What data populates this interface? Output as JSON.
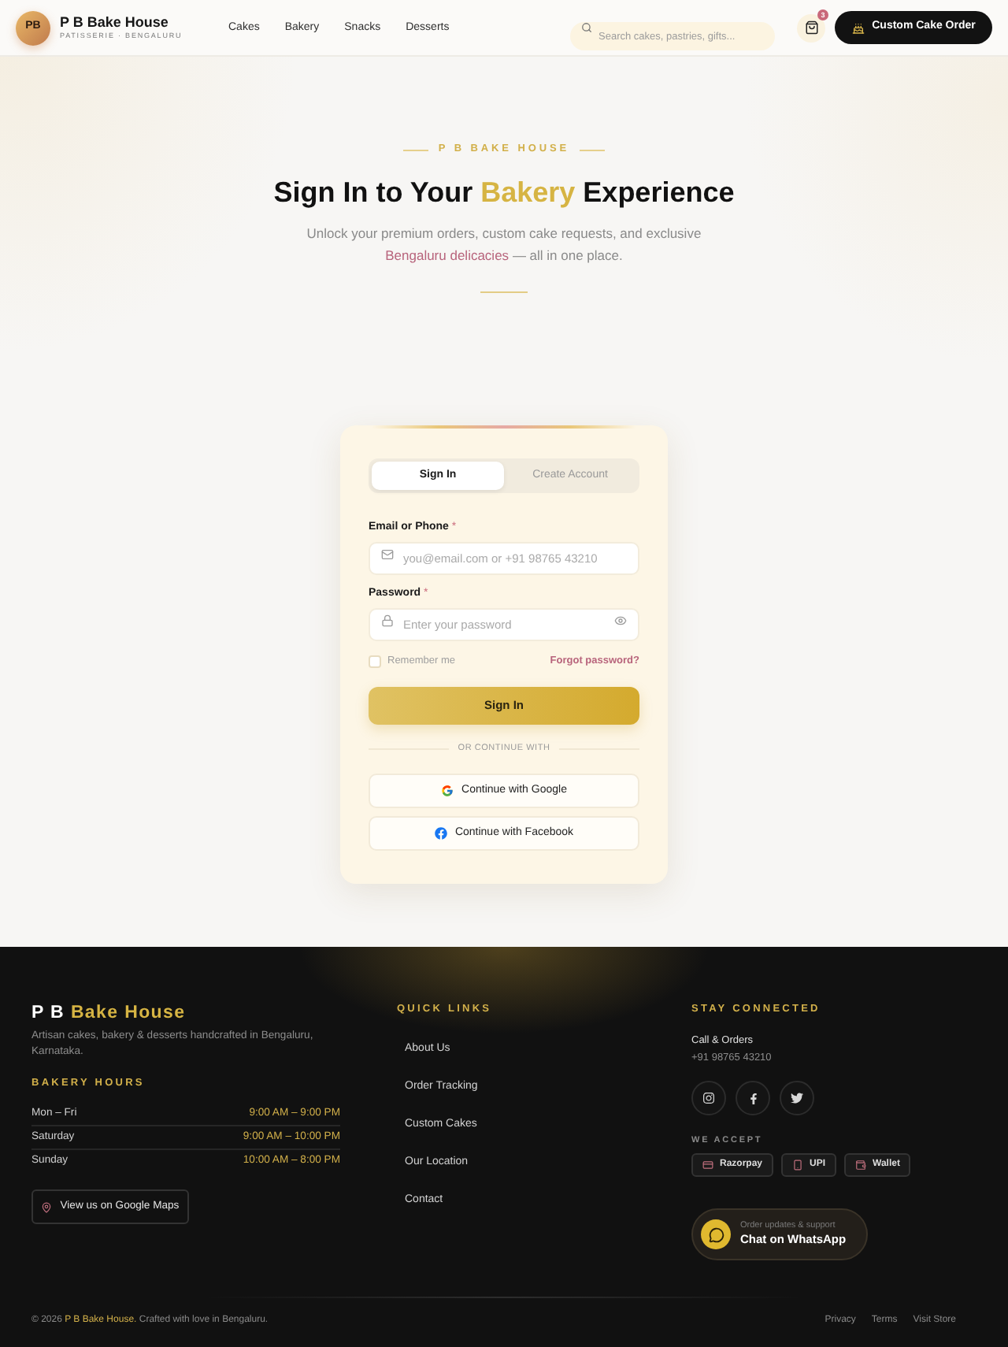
{
  "header": {
    "logo": {
      "initials": "PB",
      "name": "P B Bake House",
      "tagline": "PATISSERIE · BENGALURU"
    },
    "nav": [
      {
        "label": "Cakes"
      },
      {
        "label": "Bakery"
      },
      {
        "label": "Snacks"
      },
      {
        "label": "Desserts"
      }
    ],
    "search": {
      "placeholder": "Search cakes, pastries, gifts..."
    },
    "cart": {
      "count": "3"
    },
    "cta": {
      "label": "Custom Cake Order"
    }
  },
  "hero": {
    "eyebrow": "P B BAKE HOUSE",
    "title": [
      {
        "text": "Sign In to Your",
        "highlight": false
      },
      {
        "text": "Bakery",
        "highlight": true
      },
      {
        "text": "Experience",
        "highlight": false
      }
    ],
    "subtitle": [
      {
        "text": "Unlock your premium orders, custom cake requests, and exclusive",
        "highlight": false
      },
      {
        "text": "Bengaluru delicacies",
        "highlight": true
      },
      {
        "text": "— all in one place.",
        "highlight": false
      }
    ]
  },
  "form": {
    "tabs": [
      {
        "label": "Sign In",
        "selected": true
      },
      {
        "label": "Create Account",
        "selected": false
      }
    ],
    "fields": [
      {
        "kind": "email",
        "label": "Email or Phone",
        "required_mark": "*",
        "placeholder": "you@email.com or +91 98765 43210"
      },
      {
        "kind": "password",
        "label": "Password",
        "required_mark": "*",
        "placeholder": "Enter your password"
      }
    ],
    "remember": {
      "label": "Remember me",
      "checked": false
    },
    "forgot": "Forgot password?",
    "submit": "Sign In",
    "divider": "OR CONTINUE WITH",
    "social": [
      {
        "kind": "google",
        "label": "Continue with Google"
      },
      {
        "kind": "facebook",
        "label": "Continue with Facebook"
      }
    ]
  },
  "footer": {
    "brand": [
      {
        "text": "P B",
        "highlight": false
      },
      {
        "text": "Bake House",
        "highlight": true
      }
    ],
    "description": "Artisan cakes, bakery & desserts handcrafted in Bengaluru, Karnataka.",
    "hours_title": "BAKERY HOURS",
    "hours": [
      {
        "day": "Mon – Fri",
        "time": "9:00 AM – 9:00 PM"
      },
      {
        "day": "Saturday",
        "time": "9:00 AM – 10:00 PM"
      },
      {
        "day": "Sunday",
        "time": "10:00 AM – 8:00 PM"
      }
    ],
    "map_button": "View us on Google Maps",
    "links_title": "QUICK LINKS",
    "links": [
      "About Us",
      "Order Tracking",
      "Custom Cakes",
      "Our Location",
      "Contact"
    ],
    "connect_title": "STAY CONNECTED",
    "call_label": "Call & Orders",
    "phone": "+91 98765 43210",
    "payments_title": "WE ACCEPT",
    "payments": [
      {
        "kind": "card",
        "label": "Razorpay"
      },
      {
        "kind": "phone",
        "label": "UPI"
      },
      {
        "kind": "wallet",
        "label": "Wallet"
      }
    ],
    "whatsapp": {
      "caption": "Order updates & support",
      "label": "Chat on WhatsApp"
    },
    "copyright": [
      {
        "text": "© 2026",
        "highlight": false
      },
      {
        "text": "P B Bake House.",
        "highlight": true
      },
      {
        "text": "Crafted with love in Bengaluru.",
        "highlight": false
      }
    ],
    "legal_links": [
      "Privacy",
      "Terms",
      "Visit Store"
    ]
  }
}
